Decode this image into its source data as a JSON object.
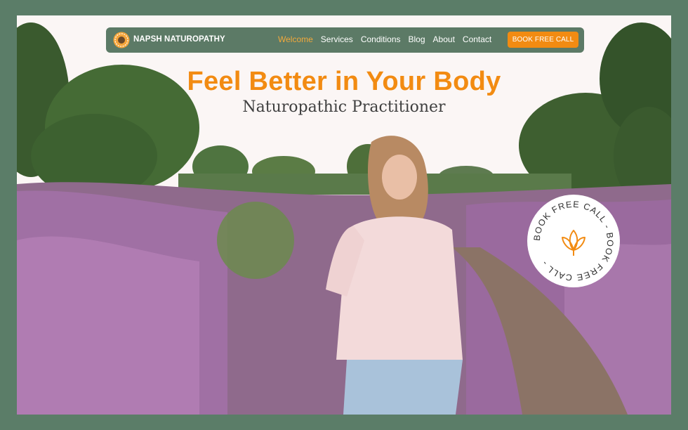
{
  "brand": {
    "name": "NAPSH NATUROPATHY",
    "logo_icon": "sunflower-icon"
  },
  "nav": {
    "items": [
      {
        "label": "Welcome",
        "active": true
      },
      {
        "label": "Services",
        "active": false
      },
      {
        "label": "Conditions",
        "active": false
      },
      {
        "label": "Blog",
        "active": false
      },
      {
        "label": "About",
        "active": false
      },
      {
        "label": "Contact",
        "active": false
      }
    ],
    "cta_label": "BOOK FREE CALL"
  },
  "hero": {
    "title": "Feel Better in Your Body",
    "subtitle": "Naturopathic Practitioner",
    "badge_text": "BOOK FREE CALL - BOOK FREE CALL - ",
    "badge_icon": "lotus-icon"
  },
  "colors": {
    "frame": "#5b7d68",
    "nav_bg": "#5c7a66",
    "accent_orange": "#f28b12",
    "active_link": "#f2a93b",
    "heather": "#9a6a9e"
  }
}
